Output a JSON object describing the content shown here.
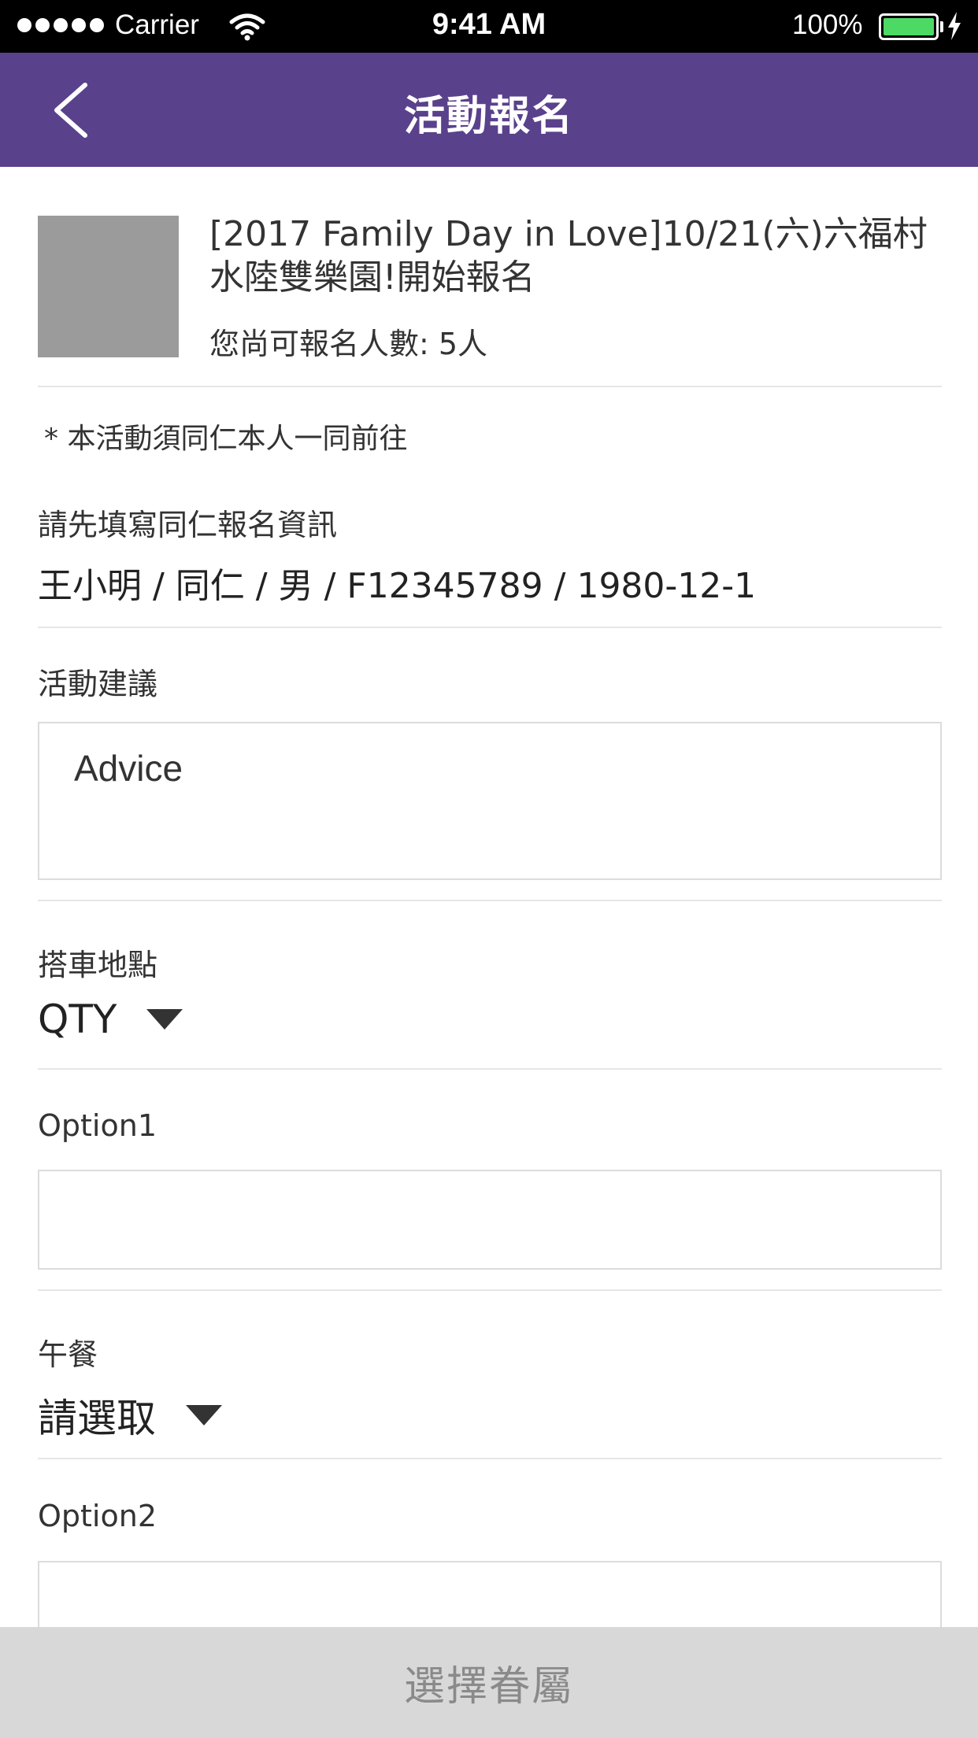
{
  "status_bar": {
    "carrier": "Carrier",
    "time": "9:41 AM",
    "battery": "100%",
    "battery_level": 1.0,
    "battery_color": "#4cd964"
  },
  "nav": {
    "title": "活動報名",
    "back_icon": "chevron-left-icon",
    "color": "#5a418c"
  },
  "event": {
    "title": "[2017 Family Day in Love]10/21(六)六福村水陸雙樂園!開始報名",
    "quota": "您尚可報名人數: 5人"
  },
  "form": {
    "note": "* 本活動須同仁本人一同前往",
    "employee_label": "請先填寫同仁報名資訊",
    "employee_value": "王小明 / 同仁 / 男 / F12345789 / 1980-12-1",
    "advice_label": "活動建議",
    "advice_placeholder": "Advice",
    "pickup_label": "搭車地點",
    "pickup_value": "QTY",
    "option1_label": "Option1",
    "option1_value": "",
    "lunch_label": "午餐",
    "lunch_value": "請選取",
    "option2_label": "Option2",
    "option2_value": ""
  },
  "footer": {
    "button_label": "選擇眷屬"
  }
}
